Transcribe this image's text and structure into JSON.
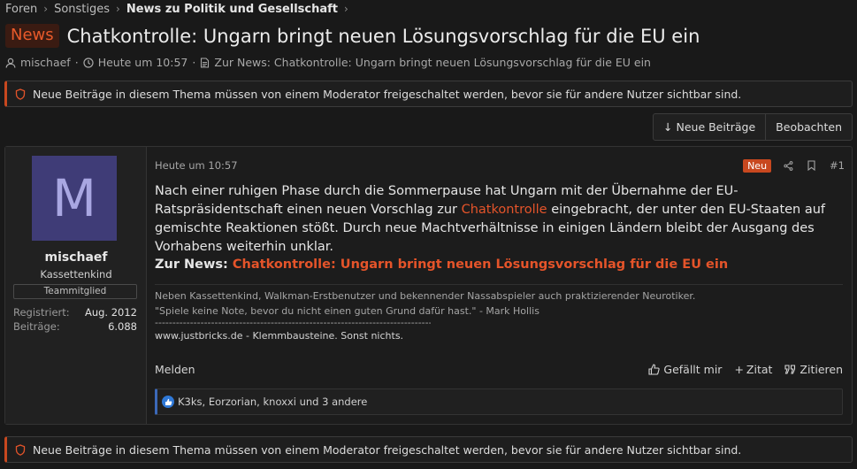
{
  "breadcrumb": {
    "items": [
      "Foren",
      "Sonstiges"
    ],
    "current": "News zu Politik und Gesellschaft"
  },
  "thread": {
    "prefix": "News",
    "title": "Chatkontrolle: Ungarn bringt neuen Lösungsvorschlag für die EU ein",
    "author": "mischaef",
    "time": "Heute um 10:57",
    "source_link": "Zur News: Chatkontrolle: Ungarn bringt neuen Lösungsvorschlag für die EU ein"
  },
  "notice": {
    "text": "Neue Beiträge in diesem Thema müssen von einem Moderator freigeschaltet werden, bevor sie für andere Nutzer sichtbar sind."
  },
  "actions": {
    "new_posts": "↓ Neue Beiträge",
    "watch": "Beobachten"
  },
  "post": {
    "user": {
      "avatar_letter": "M",
      "name": "mischaef",
      "title": "Kassettenkind",
      "banner": "Teammitglied",
      "registered_label": "Registriert:",
      "registered_value": "Aug. 2012",
      "posts_label": "Beiträge:",
      "posts_value": "6.088"
    },
    "time": "Heute um 10:57",
    "new_label": "Neu",
    "number": "#1",
    "text_1": "Nach einer ruhigen Phase durch die Sommerpause hat Ungarn mit der Übernahme der EU-Ratspräsidentschaft einen neuen Vorschlag zur ",
    "text_link": "Chatkontrolle",
    "text_2": " eingebracht, der unter den EU-Staaten auf gemischte Reaktionen stößt. Durch neue Machtverhältnisse in einigen Ländern bleibt der Ausgang des Vorhabens weiterhin unklar.",
    "zur_label": "Zur News:",
    "zur_link": "Chatkontrolle: Ungarn bringt neuen Lösungsvorschlag für die EU ein",
    "signature": {
      "line1": "Neben Kassettenkind, Walkman-Erstbenutzer und bekennender Nassabspieler auch praktizierender Neurotiker.",
      "line2": "\"Spiele keine Note, bevor du nicht einen guten Grund dafür hast.\" - Mark Hollis",
      "divider": "--------------------------------------------------------------------------------",
      "line3": "www.justbricks.de - Klemmbausteine. Sonst nichts."
    },
    "report": "Melden",
    "like": "Gefällt mir",
    "quote": "Zitat",
    "reply": "Zitieren",
    "reactions": "K3ks, Eorzorian, knoxxi und 3 andere"
  },
  "colors": {
    "accent": "#e5542a",
    "background": "#191919",
    "avatar_bg": "#3f3c77",
    "reaction_blue": "#2f78d6"
  }
}
